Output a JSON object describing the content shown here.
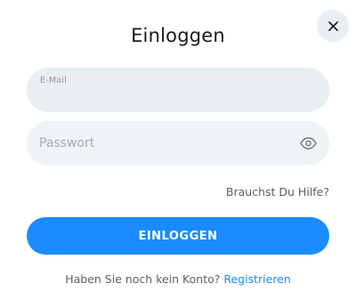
{
  "dialog": {
    "title": "Einloggen",
    "close_icon": "close-icon"
  },
  "email": {
    "label": "E-Mail",
    "value": ""
  },
  "password": {
    "placeholder": "Passwort",
    "value": "",
    "toggle_icon": "eye-icon"
  },
  "help_link": "Brauchst Du Hilfe?",
  "login_button": "EINLOGGEN",
  "footer": {
    "prompt": "Haben Sie noch kein Konto?",
    "register_link": "Registrieren"
  },
  "colors": {
    "accent": "#1a8cff",
    "field_bg": "#e8eef1",
    "close_bg": "#e9eef2"
  }
}
